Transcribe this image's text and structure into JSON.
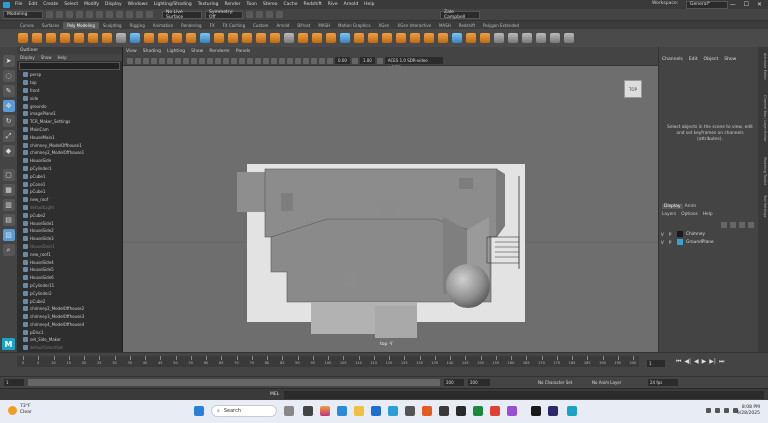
{
  "menubar": {
    "items": [
      "File",
      "Edit",
      "Create",
      "Select",
      "Modify",
      "Display",
      "Windows",
      "Lighting/Shading",
      "Texturing",
      "Render",
      "Toon",
      "Stereo",
      "Cache",
      "Redshift",
      "Rive",
      "Arnold",
      "Help"
    ],
    "workspace_label": "Workspace:",
    "workspace_value": "General*",
    "window_controls": [
      "—",
      "☐",
      "✕"
    ]
  },
  "statusline": {
    "mode": "Modeling",
    "objects_dropdown": "No Live Surface",
    "symmetry": "Symmetry: Off",
    "user": "Zale Campbell"
  },
  "shelf_tabs": [
    "Curves",
    "Surfaces",
    "Poly Modeling",
    "Sculpting",
    "Rigging",
    "Animation",
    "Rendering",
    "FX",
    "FX Caching",
    "Custom",
    "Arnold",
    "Bifrost",
    "MASH",
    "Motion Graphics",
    "XGen",
    "XGen Interactive",
    "MASH",
    "Redshift",
    "Polygon Extended"
  ],
  "shelf_active_index": 2,
  "outliner": {
    "title": "Outliner",
    "menu": [
      "Display",
      "Show",
      "Help"
    ],
    "items": [
      {
        "label": "persp",
        "dim": false
      },
      {
        "label": "top",
        "dim": false
      },
      {
        "label": "front",
        "dim": false
      },
      {
        "label": "side",
        "dim": false
      },
      {
        "label": "groundo",
        "dim": false
      },
      {
        "label": "imagePlane1",
        "dim": false
      },
      {
        "label": "TCR_Maker_Settings",
        "dim": false
      },
      {
        "label": "MainCam",
        "dim": false
      },
      {
        "label": "HouseMain1",
        "dim": false
      },
      {
        "label": "chimney_ModelOffhouse1",
        "dim": false
      },
      {
        "label": "chimney2_ModelOffhouse1",
        "dim": false
      },
      {
        "label": "HouseSide",
        "dim": false
      },
      {
        "label": "pCylinder1",
        "dim": false
      },
      {
        "label": "pCube1",
        "dim": false
      },
      {
        "label": "pCone1",
        "dim": false
      },
      {
        "label": "pCube1",
        "dim": false
      },
      {
        "label": "new_roof",
        "dim": false
      },
      {
        "label": "defaultLight",
        "dim": true
      },
      {
        "label": "pCube2",
        "dim": false
      },
      {
        "label": "HouseSide1",
        "dim": false
      },
      {
        "label": "HouseSide2",
        "dim": false
      },
      {
        "label": "HouseSide3",
        "dim": false
      },
      {
        "label": "HouseDoor1",
        "dim": true
      },
      {
        "label": "new_roof1",
        "dim": false
      },
      {
        "label": "HouseSide4",
        "dim": false
      },
      {
        "label": "HouseSide5",
        "dim": false
      },
      {
        "label": "HouseSide6",
        "dim": false
      },
      {
        "label": "pCylinder11",
        "dim": false
      },
      {
        "label": "pCylinder2",
        "dim": false
      },
      {
        "label": "pCube2",
        "dim": false
      },
      {
        "label": "chimney2_ModelOffhouse2",
        "dim": false
      },
      {
        "label": "chimney3_ModelOffhouse3",
        "dim": false
      },
      {
        "label": "chimney4_ModelOffhouse4",
        "dim": false
      },
      {
        "label": "pDisc1",
        "dim": false
      },
      {
        "label": "set_Side_Maker",
        "dim": false
      },
      {
        "label": "defaultSelectSet",
        "dim": true
      }
    ]
  },
  "viewport": {
    "menu": [
      "View",
      "Shading",
      "Lighting",
      "Show",
      "Renderer",
      "Panels"
    ],
    "field1": "0.00",
    "field2": "1.00",
    "colorspace": "ACES 1.0 SDR-video (sRGB)",
    "camera_label": "top -Y",
    "viewcube_label": "TOP"
  },
  "channelbox": {
    "menu": [
      "Channels",
      "Edit",
      "Object",
      "Show"
    ],
    "message": "Select objects in the scene to view, edit and set keyframes on channels (attributes).",
    "layer_tabs": [
      "Display",
      "Anim"
    ],
    "layer_menu": [
      "Layers",
      "Options",
      "Help"
    ],
    "layers": [
      {
        "v": "V",
        "p": "P",
        "name": "Chimney",
        "color": "#1a1a1a"
      },
      {
        "v": "V",
        "p": "P",
        "name": "GroundPlane",
        "color": "#3aa0d8"
      }
    ],
    "side_tabs": [
      "Attribute Editor",
      "Channel Box / Layer Editor",
      "Modeling Toolkit",
      "Tool Settings"
    ]
  },
  "timeline": {
    "ticks": [
      "0",
      "5",
      "10",
      "15",
      "20",
      "25",
      "30",
      "35",
      "40",
      "45",
      "50",
      "55",
      "60",
      "65",
      "70",
      "75",
      "80",
      "85",
      "90",
      "95",
      "100",
      "105",
      "110",
      "115",
      "120",
      "125",
      "130",
      "135",
      "140",
      "145",
      "150",
      "155",
      "160",
      "165",
      "170",
      "175",
      "180",
      "185",
      "190",
      "195",
      "200"
    ],
    "current_frame": "1",
    "playback": [
      "⏮",
      "◀|",
      "◀",
      "▶",
      "▶|",
      "⏭"
    ]
  },
  "range": {
    "start": "1",
    "inner_start": "1",
    "inner_end": "200",
    "end": "200",
    "character_set": "No Character Set",
    "anim_layer": "No Anim Layer",
    "fps": "24 fps"
  },
  "cmdline": {
    "label": "MEL"
  },
  "taskbar": {
    "temp": "73°F",
    "weather": "Clear",
    "search": "Search",
    "time": "8:08 PM",
    "date": "9/28/2025"
  }
}
